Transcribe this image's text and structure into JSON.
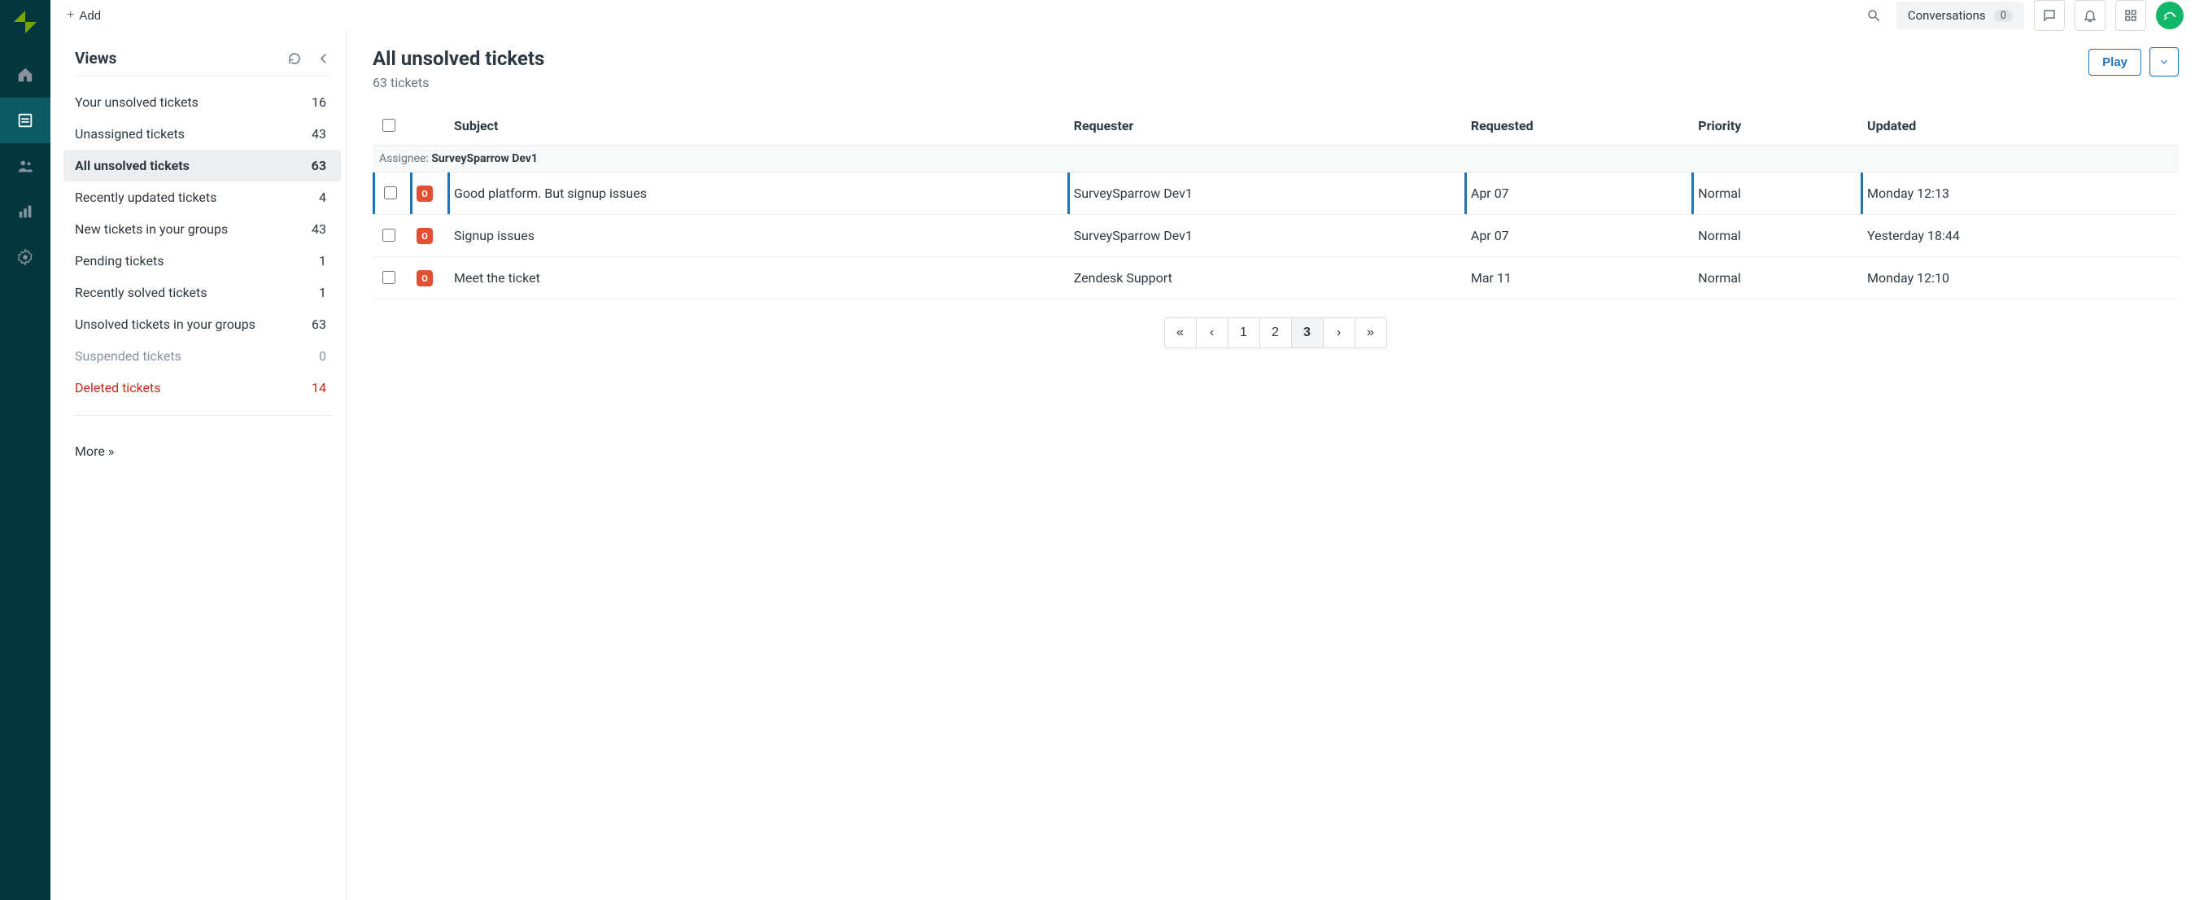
{
  "topbar": {
    "add_label": "Add",
    "conversations_label": "Conversations",
    "conversations_count": "0"
  },
  "sidebar": {
    "title": "Views",
    "more_label": "More »",
    "items": [
      {
        "label": "Your unsolved tickets",
        "count": "16",
        "state": "normal"
      },
      {
        "label": "Unassigned tickets",
        "count": "43",
        "state": "normal"
      },
      {
        "label": "All unsolved tickets",
        "count": "63",
        "state": "active"
      },
      {
        "label": "Recently updated tickets",
        "count": "4",
        "state": "normal"
      },
      {
        "label": "New tickets in your groups",
        "count": "43",
        "state": "normal"
      },
      {
        "label": "Pending tickets",
        "count": "1",
        "state": "normal"
      },
      {
        "label": "Recently solved tickets",
        "count": "1",
        "state": "normal"
      },
      {
        "label": "Unsolved tickets in your groups",
        "count": "63",
        "state": "normal"
      },
      {
        "label": "Suspended tickets",
        "count": "0",
        "state": "muted"
      },
      {
        "label": "Deleted tickets",
        "count": "14",
        "state": "danger"
      }
    ]
  },
  "main": {
    "title": "All unsolved tickets",
    "subtitle": "63 tickets",
    "play_label": "Play",
    "columns": {
      "subject": "Subject",
      "requester": "Requester",
      "requested": "Requested",
      "priority": "Priority",
      "updated": "Updated"
    },
    "group": {
      "label": "Assignee:",
      "value": "SurveySparrow Dev1"
    },
    "status_badge_letter": "O",
    "rows": [
      {
        "subject": "Good platform. But signup issues",
        "requester": "SurveySparrow Dev1",
        "requested": "Apr 07",
        "priority": "Normal",
        "updated": "Monday 12:13"
      },
      {
        "subject": "Signup issues",
        "requester": "SurveySparrow Dev1",
        "requested": "Apr 07",
        "priority": "Normal",
        "updated": "Yesterday 18:44"
      },
      {
        "subject": "Meet the ticket",
        "requester": "Zendesk Support",
        "requested": "Mar 11",
        "priority": "Normal",
        "updated": "Monday 12:10"
      }
    ],
    "pagination": {
      "first": "«",
      "prev": "‹",
      "pages": [
        "1",
        "2",
        "3"
      ],
      "active_index": 2,
      "next": "›",
      "last": "»"
    }
  }
}
